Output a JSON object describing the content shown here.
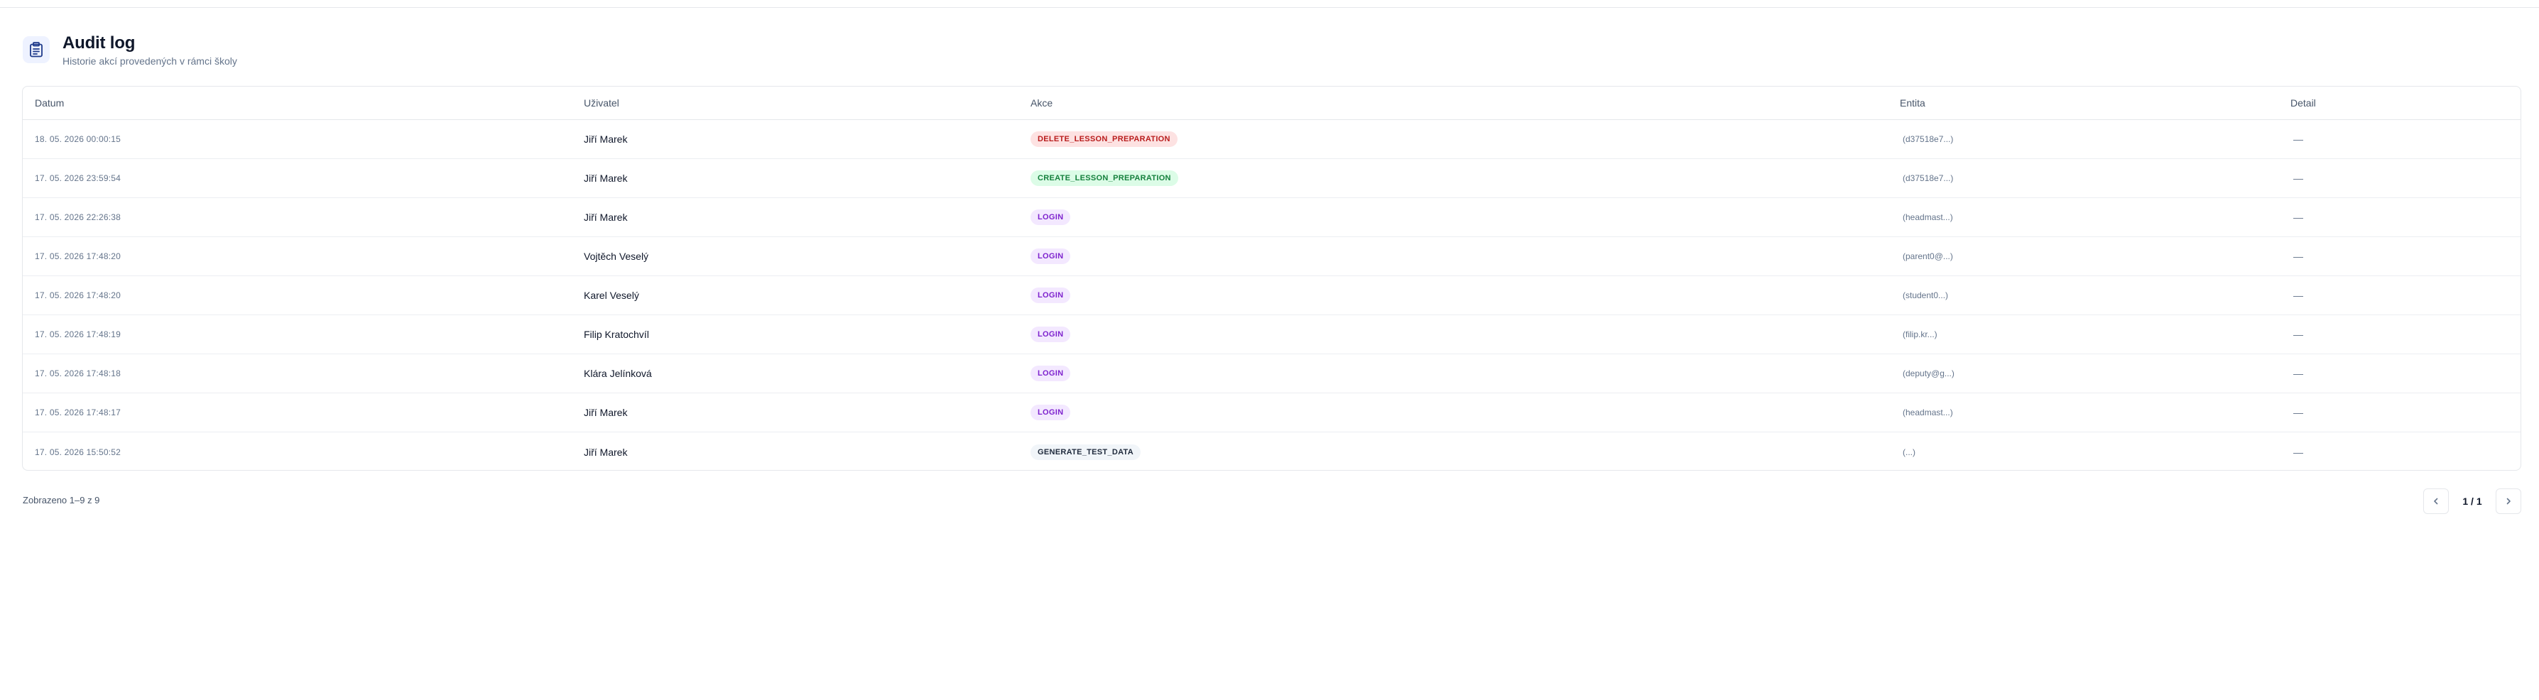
{
  "header": {
    "title": "Audit log",
    "subtitle": "Historie akcí provedených v rámci školy",
    "icon": "clipboard-icon"
  },
  "table": {
    "columns": [
      "Datum",
      "Uživatel",
      "Akce",
      "Entita",
      "Detail"
    ],
    "rows": [
      {
        "date": "18. 05. 2026 00:00:15",
        "user": "Jiří Marek",
        "action": "DELETE_LESSON_PREPARATION",
        "action_type": "delete",
        "entity": "(d37518e7...)",
        "detail": "—"
      },
      {
        "date": "17. 05. 2026 23:59:54",
        "user": "Jiří Marek",
        "action": "CREATE_LESSON_PREPARATION",
        "action_type": "create",
        "entity": "(d37518e7...)",
        "detail": "—"
      },
      {
        "date": "17. 05. 2026 22:26:38",
        "user": "Jiří Marek",
        "action": "LOGIN",
        "action_type": "login",
        "entity": "(headmast...)",
        "detail": "—"
      },
      {
        "date": "17. 05. 2026 17:48:20",
        "user": "Vojtěch Veselý",
        "action": "LOGIN",
        "action_type": "login",
        "entity": "(parent0@...)",
        "detail": "—"
      },
      {
        "date": "17. 05. 2026 17:48:20",
        "user": "Karel Veselý",
        "action": "LOGIN",
        "action_type": "login",
        "entity": "(student0...)",
        "detail": "—"
      },
      {
        "date": "17. 05. 2026 17:48:19",
        "user": "Filip Kratochvíl",
        "action": "LOGIN",
        "action_type": "login",
        "entity": "(filip.kr...)",
        "detail": "—"
      },
      {
        "date": "17. 05. 2026 17:48:18",
        "user": "Klára Jelínková",
        "action": "LOGIN",
        "action_type": "login",
        "entity": "(deputy@g...)",
        "detail": "—"
      },
      {
        "date": "17. 05. 2026 17:48:17",
        "user": "Jiří Marek",
        "action": "LOGIN",
        "action_type": "login",
        "entity": "(headmast...)",
        "detail": "—"
      },
      {
        "date": "17. 05. 2026 15:50:52",
        "user": "Jiří Marek",
        "action": "GENERATE_TEST_DATA",
        "action_type": "generate",
        "entity": "(...)",
        "detail": "—"
      }
    ]
  },
  "footer": {
    "count_text": "Zobrazeno 1–9 z 9",
    "page_label": "1 / 1",
    "prev_icon": "chevron-left-icon",
    "next_icon": "chevron-right-icon"
  },
  "colors": {
    "delete_bg": "#fde2e2",
    "delete_fg": "#b91c1c",
    "create_bg": "#dcfce7",
    "create_fg": "#15803d",
    "login_bg": "#f3e8ff",
    "login_fg": "#7e22ce",
    "generate_bg": "#f1f5f9",
    "generate_fg": "#1e293b"
  }
}
